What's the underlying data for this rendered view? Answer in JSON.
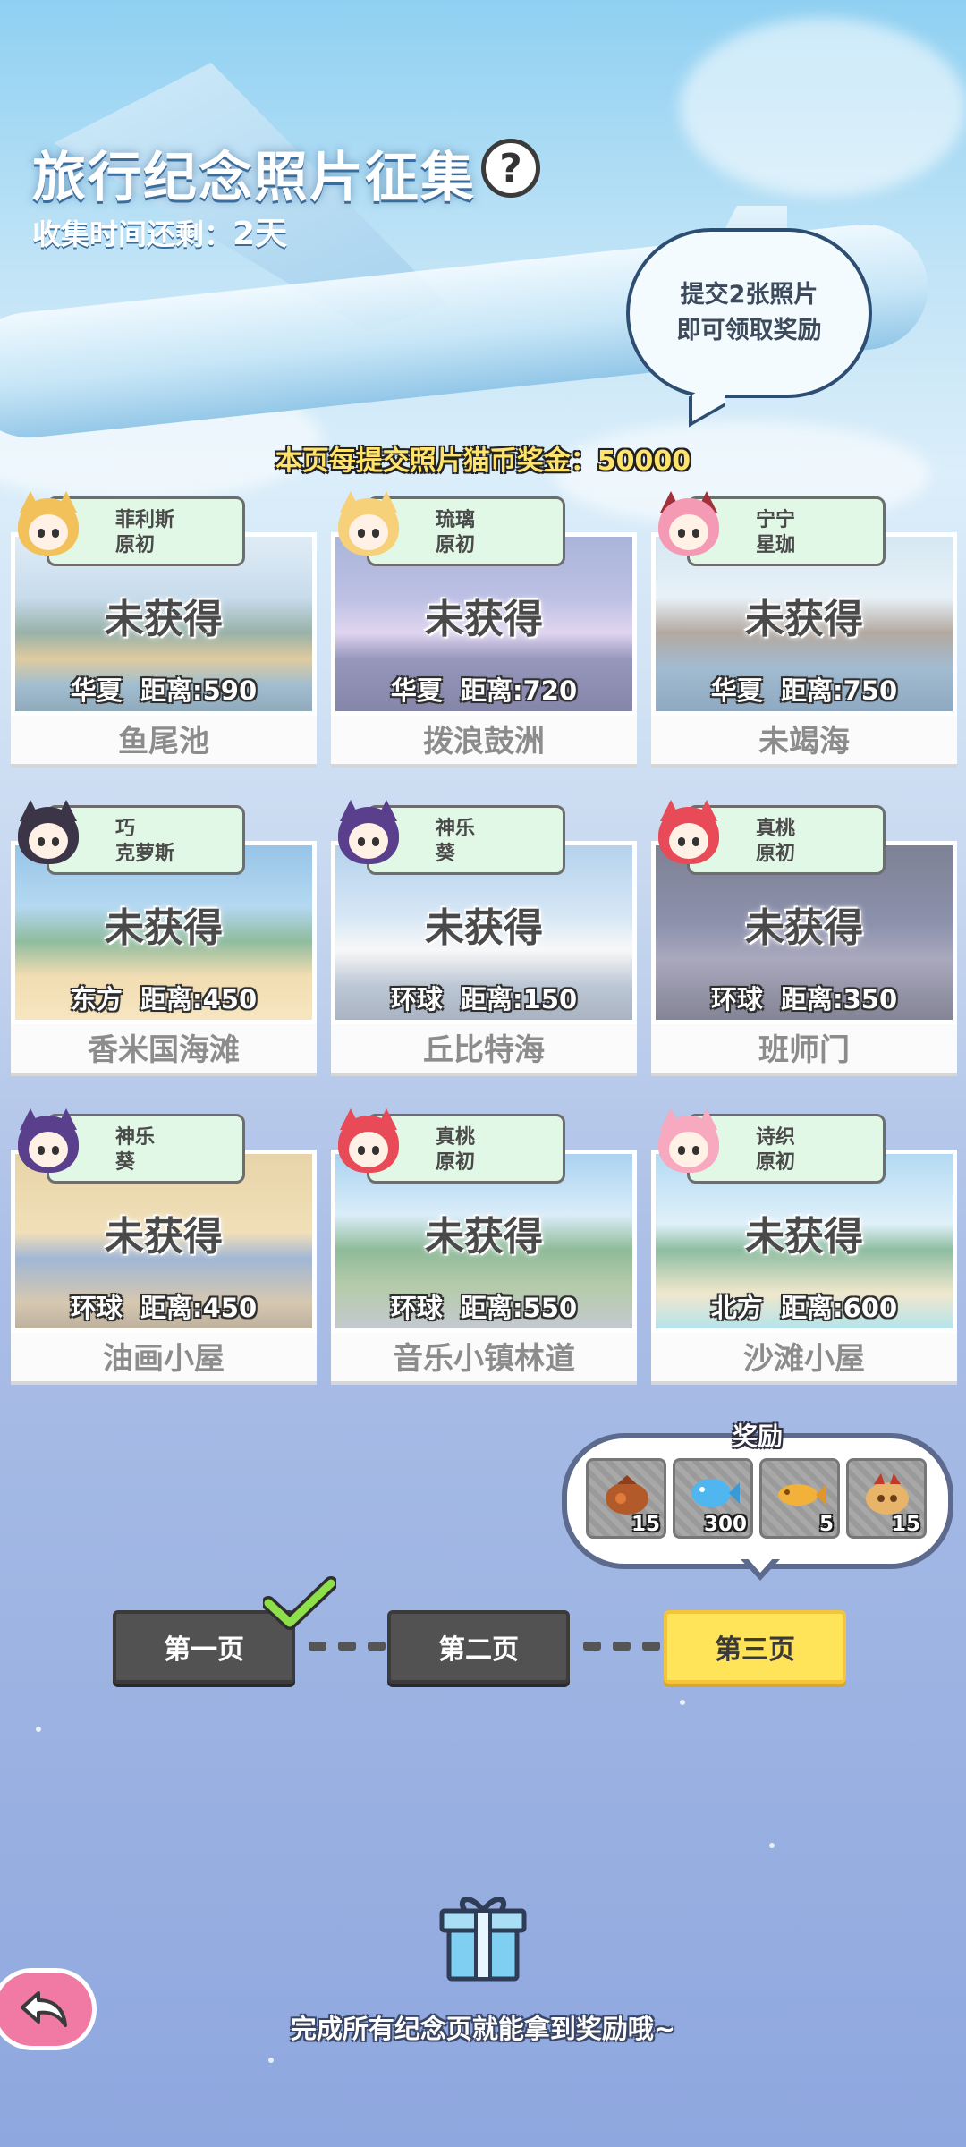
{
  "header": {
    "title": "旅行纪念照片征集",
    "help_icon": "?",
    "time_label": "收集时间还剩：",
    "time_value": "2天",
    "bubble_line1": "提交2张照片",
    "bubble_line2": "即可领取奖励",
    "bonus_text": "本页每提交照片猫币奖金：50000"
  },
  "cards": [
    {
      "char_line1": "菲利斯",
      "char_line2": "原初",
      "status": "未获得",
      "region": "华夏",
      "distance": "距离:590",
      "name": "鱼尾池",
      "photo": "lake",
      "hair": "#f3c15a",
      "ear": "#f3c15a"
    },
    {
      "char_line1": "琉璃",
      "char_line2": "原初",
      "status": "未获得",
      "region": "华夏",
      "distance": "距离:720",
      "name": "拨浪鼓洲",
      "photo": "city-night",
      "hair": "#f6d179",
      "ear": "#f6d179"
    },
    {
      "char_line1": "宁宁",
      "char_line2": "星珈",
      "status": "未获得",
      "region": "华夏",
      "distance": "距离:750",
      "name": "未竭海",
      "photo": "coast",
      "hair": "#f59ab4",
      "ear": "#a3313c"
    },
    {
      "char_line1": "巧",
      "char_line2": "克萝斯",
      "status": "未获得",
      "region": "东方",
      "distance": "距离:450",
      "name": "香米国海滩",
      "photo": "beach",
      "hair": "#3b3547",
      "ear": "#3b3547"
    },
    {
      "char_line1": "神乐",
      "char_line2": "葵",
      "status": "未获得",
      "region": "环球",
      "distance": "距离:150",
      "name": "丘比特海",
      "photo": "santorini",
      "hair": "#5a3f8c",
      "ear": "#5a3f8c"
    },
    {
      "char_line1": "真桃",
      "char_line2": "原初",
      "status": "未获得",
      "region": "环球",
      "distance": "距离:350",
      "name": "班师门",
      "photo": "arch",
      "hair": "#e84a58",
      "ear": "#e84a58"
    },
    {
      "char_line1": "神乐",
      "char_line2": "葵",
      "status": "未获得",
      "region": "环球",
      "distance": "距离:450",
      "name": "油画小屋",
      "photo": "house",
      "hair": "#5a3f8c",
      "ear": "#5a3f8c"
    },
    {
      "char_line1": "真桃",
      "char_line2": "原初",
      "status": "未获得",
      "region": "环球",
      "distance": "距离:550",
      "name": "音乐小镇林道",
      "photo": "bridge",
      "hair": "#e84a58",
      "ear": "#e84a58"
    },
    {
      "char_line1": "诗织",
      "char_line2": "原初",
      "status": "未获得",
      "region": "北方",
      "distance": "距离:600",
      "name": "沙滩小屋",
      "photo": "palm",
      "hair": "#f7a9c0",
      "ear": "#f7a9c0"
    }
  ],
  "reward": {
    "title": "奖励",
    "items": [
      {
        "icon": "fish-bag-icon",
        "qty": "15"
      },
      {
        "icon": "blue-fish-icon",
        "qty": "300"
      },
      {
        "icon": "golden-fish-icon",
        "qty": "5"
      },
      {
        "icon": "cat-pouch-icon",
        "qty": "15"
      }
    ]
  },
  "pages": [
    {
      "label": "第一页",
      "state": "done"
    },
    {
      "label": "第二页",
      "state": "normal"
    },
    {
      "label": "第三页",
      "state": "active"
    }
  ],
  "footer": {
    "text": "完成所有纪念页就能拿到奖励哦~",
    "gift_icon": "gift-icon",
    "back_icon": "back-arrow-icon"
  },
  "colors": {
    "active_page": "#ffe45a",
    "dark_page": "#525252",
    "tag_bg": "#e2f8e6",
    "back_button": "#f07aa4"
  }
}
